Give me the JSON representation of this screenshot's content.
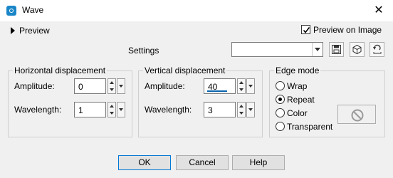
{
  "window": {
    "title": "Wave",
    "close_glyph": "✕"
  },
  "preview": {
    "label": "Preview"
  },
  "preview_on_image": {
    "label": "Preview on Image",
    "checked": true
  },
  "settings": {
    "label": "Settings",
    "value": ""
  },
  "toolbar": {
    "icons": [
      "save-preset-icon",
      "manage-presets-icon",
      "reset-icon"
    ]
  },
  "horizontal": {
    "title": "Horizontal displacement",
    "amplitude_label": "Amplitude:",
    "amplitude_value": "0",
    "wavelength_label": "Wavelength:",
    "wavelength_value": "1"
  },
  "vertical": {
    "title": "Vertical displacement",
    "amplitude_label": "Amplitude:",
    "amplitude_value": "40",
    "wavelength_label": "Wavelength:",
    "wavelength_value": "3"
  },
  "edge_mode": {
    "title": "Edge mode",
    "options": [
      "Wrap",
      "Repeat",
      "Color",
      "Transparent"
    ],
    "selected": "Repeat"
  },
  "buttons": {
    "ok": "OK",
    "cancel": "Cancel",
    "help": "Help"
  }
}
